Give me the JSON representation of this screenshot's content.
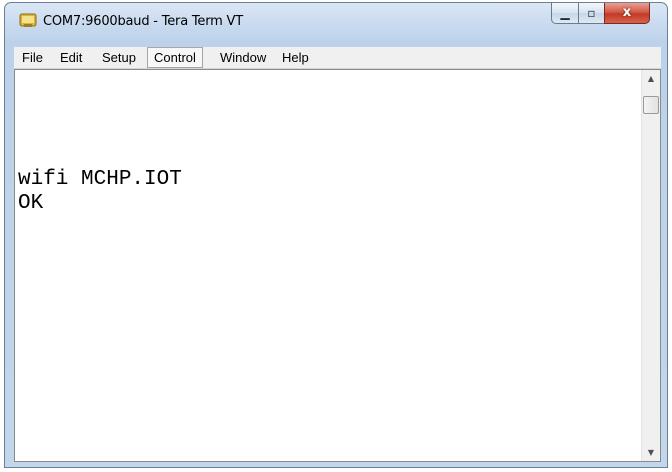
{
  "window": {
    "title": "COM7:9600baud - Tera Term VT",
    "icon": "teraterm-app-icon",
    "controls": {
      "minimize_icon": "minimize-icon",
      "maximize_icon": "maximize-icon",
      "close_icon": "close-icon",
      "minimize_glyph": "▁",
      "maximize_glyph": "▫",
      "close_glyph": "x"
    }
  },
  "menubar": {
    "items": [
      {
        "label": "File"
      },
      {
        "label": "Edit"
      },
      {
        "label": "Setup"
      },
      {
        "label": "Control"
      },
      {
        "label": "Window"
      },
      {
        "label": "Help"
      }
    ],
    "active": "Control"
  },
  "terminal": {
    "lines": [
      "wifi MCHP.IOT",
      "OK"
    ]
  },
  "scrollbar": {
    "up_glyph": "▲",
    "down_glyph": "▼"
  },
  "colors": {
    "terminal_bg": "#ffffff",
    "terminal_fg": "#000000",
    "close_button": "#c94f3c"
  }
}
